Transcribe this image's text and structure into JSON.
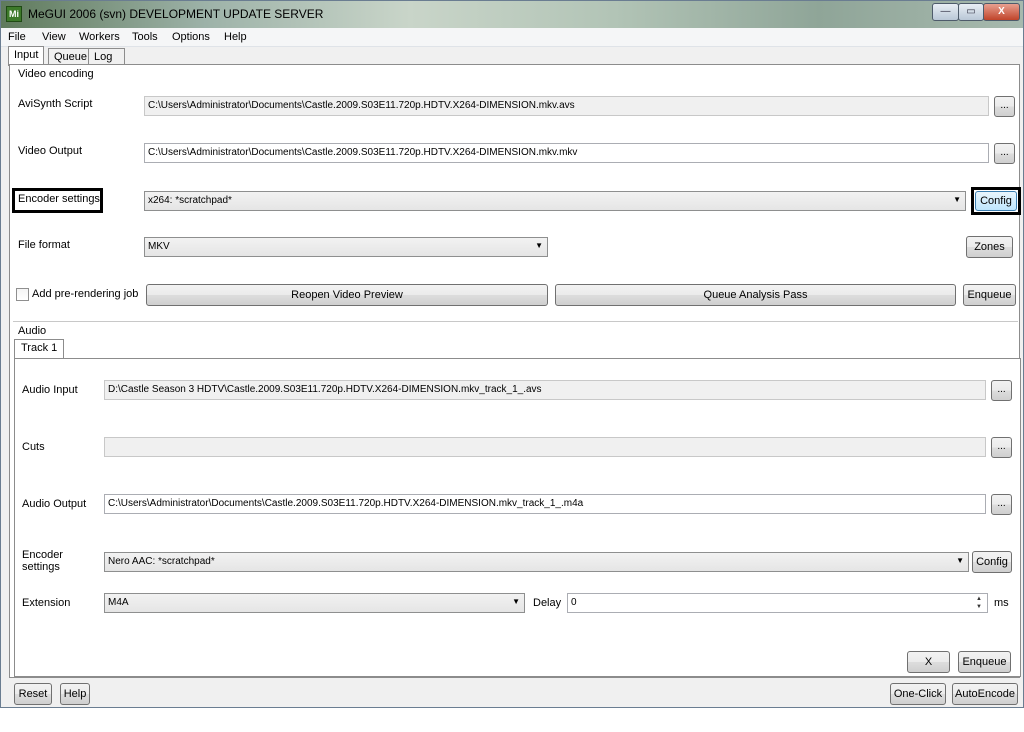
{
  "window": {
    "title": "MeGUI 2006 (svn) DEVELOPMENT UPDATE SERVER",
    "app_icon": "Mi",
    "minimize": "—",
    "maximize": "▭",
    "close": "X"
  },
  "menu": [
    "File",
    "View",
    "Workers",
    "Tools",
    "Options",
    "Help"
  ],
  "tabs": [
    "Input",
    "Queue",
    "Log"
  ],
  "video": {
    "group_title": "Video encoding",
    "avisynth_label": "AviSynth Script",
    "avisynth_value": "C:\\Users\\Administrator\\Documents\\Castle.2009.S03E11.720p.HDTV.X264-DIMENSION.mkv.avs",
    "output_label": "Video Output",
    "output_value": "C:\\Users\\Administrator\\Documents\\Castle.2009.S03E11.720p.HDTV.X264-DIMENSION.mkv.mkv",
    "encoder_label": "Encoder settings",
    "encoder_value": "x264: *scratchpad*",
    "config": "Config",
    "format_label": "File format",
    "format_value": "MKV",
    "zones": "Zones",
    "prerender_label": "Add pre-rendering job",
    "reopen": "Reopen Video Preview",
    "queue_analysis": "Queue Analysis Pass",
    "enqueue": "Enqueue",
    "browse": "..."
  },
  "audio": {
    "group_title": "Audio",
    "track_tab": "Track 1",
    "input_label": "Audio Input",
    "input_value": "D:\\Castle Season 3 HDTV\\Castle.2009.S03E11.720p.HDTV.X264-DIMENSION.mkv_track_1_.avs",
    "cuts_label": "Cuts",
    "cuts_value": "",
    "output_label": "Audio Output",
    "output_value": "C:\\Users\\Administrator\\Documents\\Castle.2009.S03E11.720p.HDTV.X264-DIMENSION.mkv_track_1_.m4a",
    "encoder_label_1": "Encoder",
    "encoder_label_2": "settings",
    "encoder_value": "Nero AAC: *scratchpad*",
    "config": "Config",
    "extension_label": "Extension",
    "extension_value": "M4A",
    "delay_label": "Delay",
    "delay_value": "0",
    "delay_unit": "ms",
    "x_button": "X",
    "enqueue": "Enqueue",
    "browse": "..."
  },
  "footer": {
    "reset": "Reset",
    "help": "Help",
    "oneclick": "One-Click",
    "autoencode": "AutoEncode"
  }
}
